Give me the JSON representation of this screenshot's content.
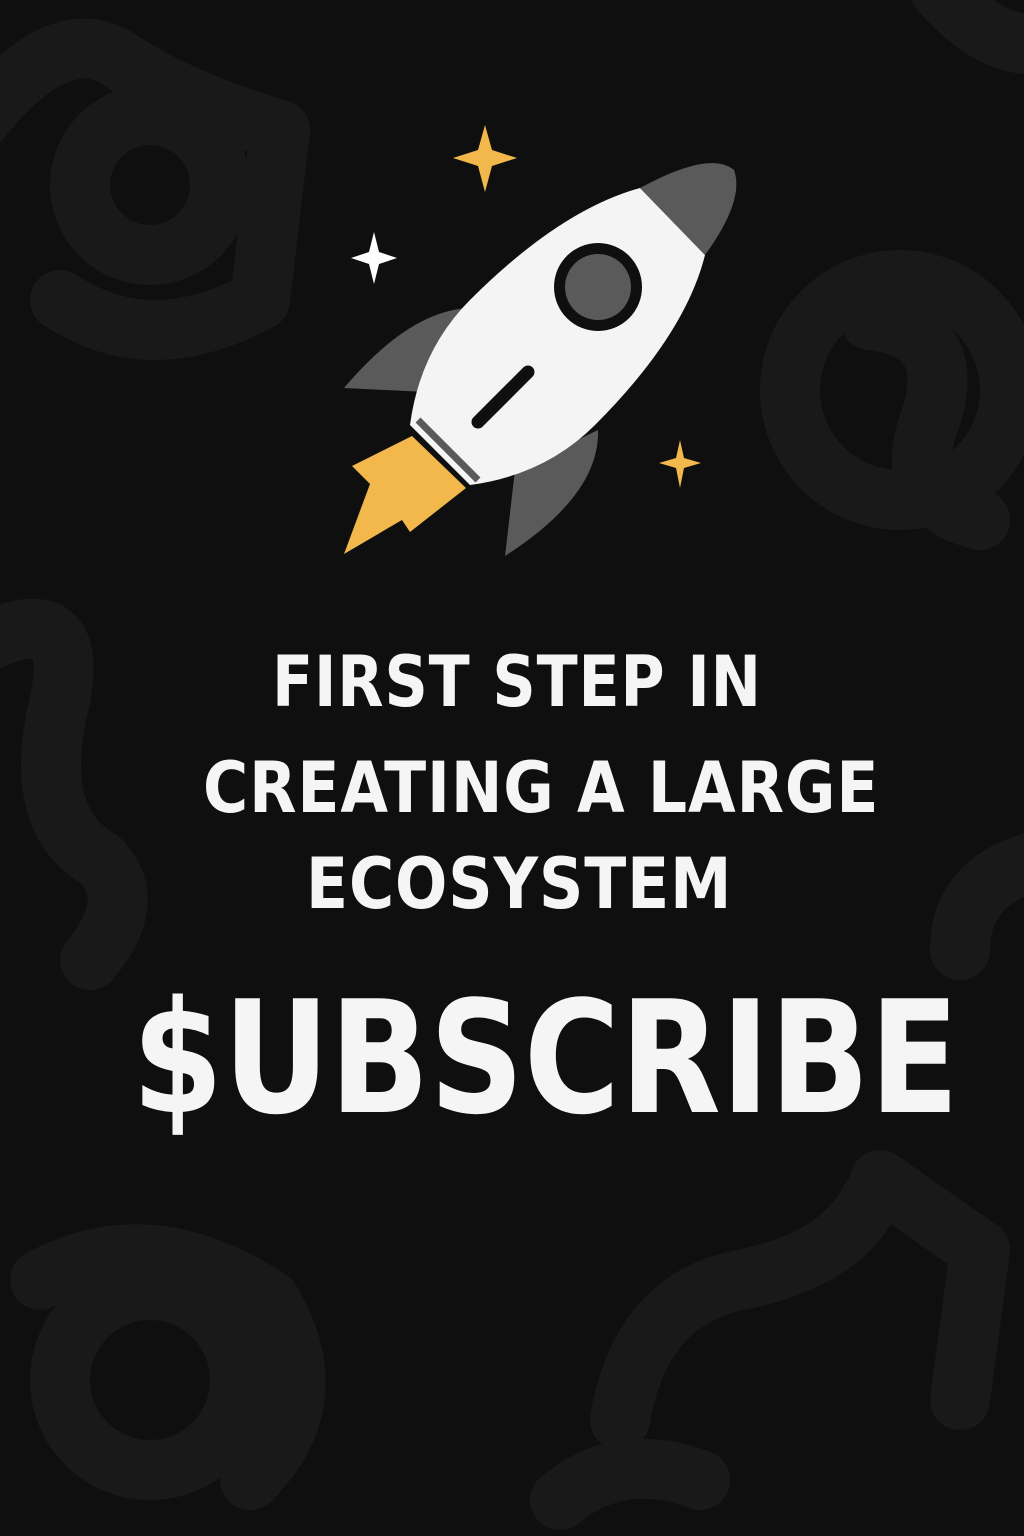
{
  "headline": {
    "line1": "FIRST STEP IN",
    "line2": "CREATING A LARGE",
    "line3": "ECOSYSTEM"
  },
  "ticker": "$UBSCRIBE",
  "colors": {
    "background": "#0f0f0f",
    "pattern": "#1b1b1b",
    "text": "#f5f5f5",
    "rocket_body": "#f4f4f4",
    "rocket_gray": "#5a5a5a",
    "flame": "#f2b84b",
    "star_accent": "#f2b84b",
    "star_white": "#ffffff"
  },
  "icons": [
    "rocket-icon",
    "star-icon"
  ]
}
